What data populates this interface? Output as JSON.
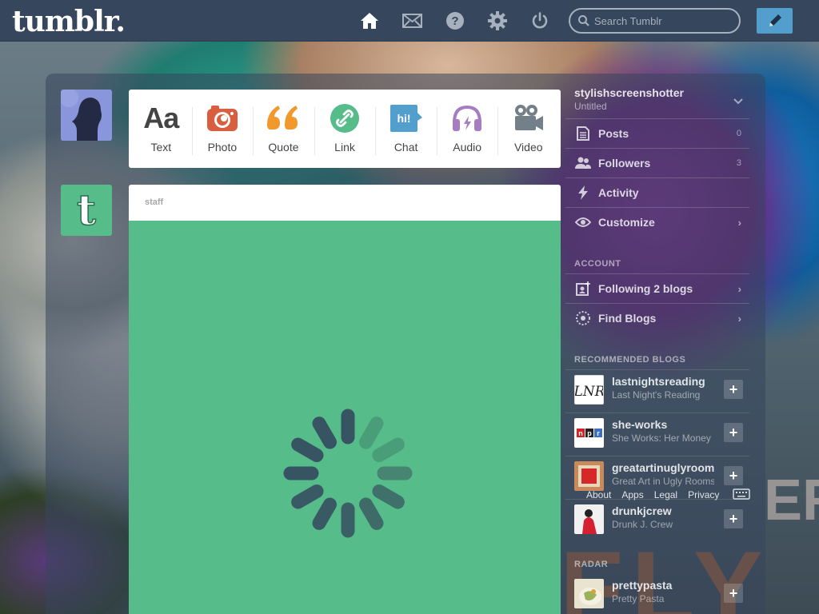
{
  "app": {
    "logo": "tumblr."
  },
  "nav": {
    "icons": [
      "home-icon",
      "mail-icon",
      "help-icon",
      "gear-icon",
      "power-icon"
    ],
    "search_placeholder": "Search Tumblr"
  },
  "post_types": [
    {
      "label": "Text",
      "icon": "text-icon",
      "color": "#444444"
    },
    {
      "label": "Photo",
      "icon": "camera-icon",
      "color": "#d95e40"
    },
    {
      "label": "Quote",
      "icon": "quote-icon",
      "color": "#f2992e"
    },
    {
      "label": "Link",
      "icon": "link-icon",
      "color": "#56bc8a"
    },
    {
      "label": "Chat",
      "icon": "chat-icon",
      "color": "#529ecc"
    },
    {
      "label": "Audio",
      "icon": "headphones-icon",
      "color": "#a77dc2"
    },
    {
      "label": "Video",
      "icon": "video-camera-icon",
      "color": "#748089"
    }
  ],
  "post": {
    "author": "staff",
    "bg_color": "#56bc8a"
  },
  "sidebar": {
    "blog_name": "stylishscreenshotter",
    "blog_title": "Untitled",
    "rows": [
      {
        "label": "Posts",
        "count": "0",
        "icon": "posts-icon"
      },
      {
        "label": "Followers",
        "count": "3",
        "icon": "followers-icon"
      },
      {
        "label": "Activity",
        "count": "",
        "icon": "lightning-icon"
      },
      {
        "label": "Customize",
        "count": "",
        "icon": "eye-icon"
      }
    ],
    "account_header": "ACCOUNT",
    "account_rows": [
      {
        "label": "Following 2 blogs",
        "icon": "following-icon"
      },
      {
        "label": "Find Blogs",
        "icon": "compass-icon"
      }
    ],
    "recommended_header": "RECOMMENDED BLOGS",
    "recommended": [
      {
        "name": "lastnightsreading",
        "subtitle": "Last Night's Reading"
      },
      {
        "name": "she-works",
        "subtitle": "She Works: Her Money"
      },
      {
        "name": "greatartinuglyrooms",
        "subtitle": "Great Art in Ugly Rooms"
      },
      {
        "name": "drunkjcrew",
        "subtitle": "Drunk J. Crew"
      }
    ],
    "radar_header": "RADAR",
    "radar": [
      {
        "name": "prettypasta",
        "subtitle": "Pretty Pasta"
      }
    ]
  },
  "footer": {
    "links": [
      "About",
      "Apps",
      "Legal",
      "Privacy"
    ]
  }
}
